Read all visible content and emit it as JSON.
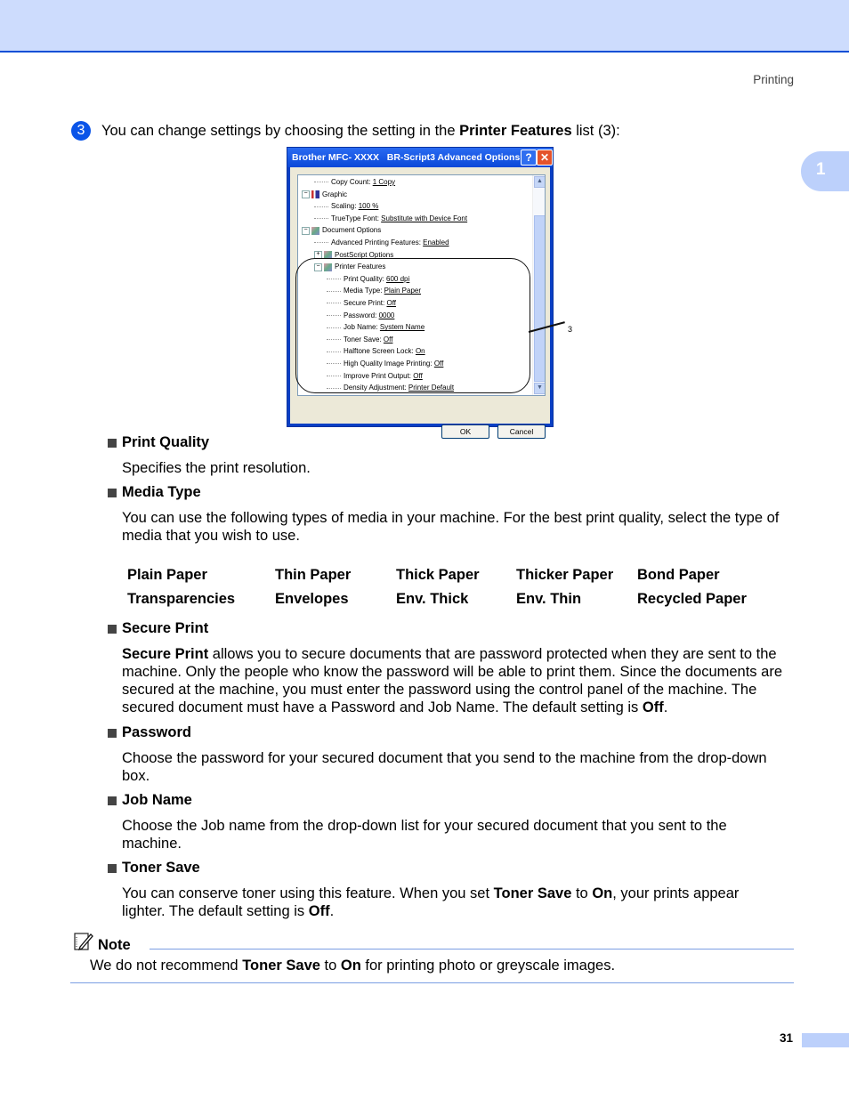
{
  "header": {
    "running_head": "Printing",
    "chapter_number": "1"
  },
  "step": {
    "number": "3",
    "text_before": "You can change settings by choosing the setting in the ",
    "text_bold": "Printer Features",
    "text_after": " list (3):"
  },
  "dialog": {
    "title": "Brother MFC- XXXX   BR-Script3 Advanced Options",
    "help_glyph": "?",
    "close_glyph": "✕",
    "tree": [
      {
        "label": "Copy Count: ",
        "value": "1 Copy",
        "level": 2
      },
      {
        "label": "Graphic",
        "value": "",
        "level": 1,
        "expander": "−",
        "icon": "graphic-icon"
      },
      {
        "label": "Scaling: ",
        "value": "100 %",
        "level": 2
      },
      {
        "label": "TrueType Font: ",
        "value": "Substitute with Device Font",
        "level": 2
      },
      {
        "label": "Document Options",
        "value": "",
        "level": 1,
        "expander": "−",
        "icon": "document-options-icon"
      },
      {
        "label": "Advanced Printing Features: ",
        "value": "Enabled",
        "level": 2
      },
      {
        "label": "PostScript Options",
        "value": "",
        "level": 2,
        "expander": "+",
        "icon": "postscript-icon"
      },
      {
        "label": "Printer Features",
        "value": "",
        "level": 2,
        "expander": "−",
        "icon": "printer-features-icon"
      },
      {
        "label": "Print Quality: ",
        "value": "600 dpi",
        "level": 3
      },
      {
        "label": "Media Type: ",
        "value": "Plain Paper",
        "level": 3
      },
      {
        "label": "Secure Print: ",
        "value": "Off",
        "level": 3
      },
      {
        "label": "Password: ",
        "value": "0000",
        "level": 3
      },
      {
        "label": "Job Name: ",
        "value": "System Name",
        "level": 3
      },
      {
        "label": "Toner Save: ",
        "value": "Off",
        "level": 3
      },
      {
        "label": "Halftone Screen Lock: ",
        "value": "On",
        "level": 3
      },
      {
        "label": "High Quality Image Printing: ",
        "value": "Off",
        "level": 3
      },
      {
        "label": "Improve Print Output: ",
        "value": "Off",
        "level": 3
      },
      {
        "label": "Density Adjustment: ",
        "value": "Printer Default",
        "level": 3
      }
    ],
    "ok_label": "OK",
    "cancel_label": "Cancel",
    "callout_number": "3"
  },
  "sections": {
    "print_quality": {
      "heading": "Print Quality",
      "body": "Specifies the print resolution."
    },
    "media_type": {
      "heading": "Media Type",
      "body": "You can use the following types of media in your machine. For the best print quality, select the type of media that you wish to use.",
      "media": [
        [
          "Plain Paper",
          "Thin Paper",
          "Thick Paper",
          "Thicker Paper",
          "Bond Paper"
        ],
        [
          "Transparencies",
          "Envelopes",
          "Env. Thick",
          "Env. Thin",
          "Recycled Paper"
        ]
      ]
    },
    "secure_print": {
      "heading": "Secure Print",
      "body_bold": "Secure Print",
      "body_line1": " allows you to secure documents that are password protected when they are sent to the",
      "body_line2": "machine. Only the people who know the password will be able to print them. Since the documents are",
      "body_line3": "secured at the machine, you must enter the password using the control panel of the machine. The",
      "body_line4_pre": "secured document must have a Password and Job Name. The default setting is ",
      "body_line4_bold": "Off",
      "body_line4_post": "."
    },
    "password": {
      "heading": "Password",
      "body_line1": "Choose the password for your secured document that you send to the machine from the drop-down",
      "body_line2": "box."
    },
    "job_name": {
      "heading": "Job Name",
      "body_line1": "Choose the Job name from the drop-down list for your secured document that you sent to the",
      "body_line2": "machine."
    },
    "toner_save": {
      "heading": "Toner Save",
      "l1_a": "You can conserve toner using this feature. When you set ",
      "l1_b": "Toner Save",
      "l1_c": " to ",
      "l1_d": "On",
      "l1_e": ", your prints appear",
      "l2_a": "lighter. The default setting is ",
      "l2_b": "Off",
      "l2_c": "."
    }
  },
  "note": {
    "label": "Note",
    "a": "We do not recommend ",
    "b": "Toner Save",
    "c": " to ",
    "d": "On",
    "e": " for printing photo or greyscale images."
  },
  "footer": {
    "page_number": "31"
  },
  "colors": {
    "header_band": "#cddcfd",
    "header_rule": "#0b4fd6",
    "step_circle": "#0a54e8",
    "tab": "#bcd0fb",
    "note_rule": "#7b9ee3"
  }
}
